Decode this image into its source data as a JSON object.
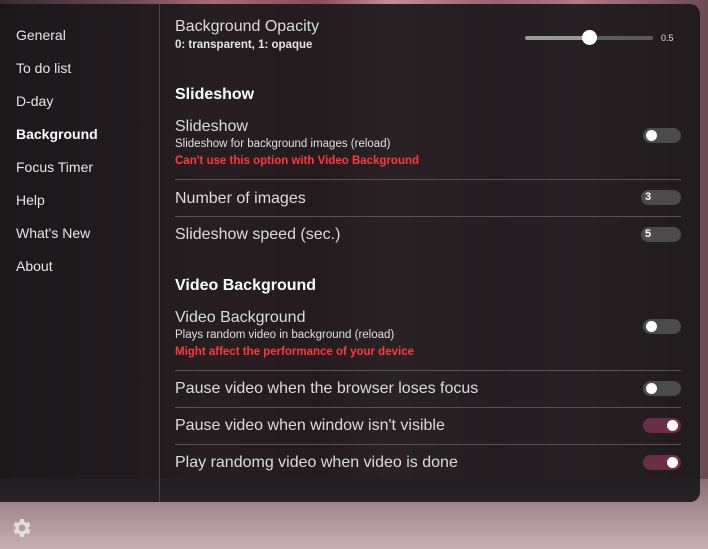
{
  "sidebar": {
    "items": [
      {
        "label": "General"
      },
      {
        "label": "To do list"
      },
      {
        "label": "D-day"
      },
      {
        "label": "Background"
      },
      {
        "label": "Focus Timer"
      },
      {
        "label": "Help"
      },
      {
        "label": "What's New"
      },
      {
        "label": "About"
      }
    ],
    "active": "Background"
  },
  "settings": {
    "opacity": {
      "title": "Background Opacity",
      "desc": "0: transparent, 1: opaque",
      "value": 0.5,
      "value_label": "0.5"
    },
    "slideshow_section": "Slideshow",
    "slideshow": {
      "title": "Slideshow",
      "desc": "Slideshow for background images (reload)",
      "warning": "Can't use this option with Video Background",
      "enabled": false
    },
    "num_images": {
      "title": "Number of images",
      "value": "3"
    },
    "slideshow_speed": {
      "title": "Slideshow speed (sec.)",
      "value": "5"
    },
    "video_section": "Video Background",
    "video_bg": {
      "title": "Video Background",
      "desc": "Plays random video in background (reload)",
      "warning": "Might affect the performance of your device",
      "enabled": false
    },
    "pause_focus": {
      "title": "Pause video when the browser loses focus",
      "enabled": false
    },
    "pause_hidden": {
      "title": "Pause video when window isn't visible",
      "enabled": true
    },
    "play_random": {
      "title": "Play randomg video when video is done",
      "enabled": true
    }
  },
  "icons": {
    "settings": "gear-icon"
  },
  "colors": {
    "accent_toggle_on": "#6a2f45",
    "warning": "#ff3a3a"
  }
}
